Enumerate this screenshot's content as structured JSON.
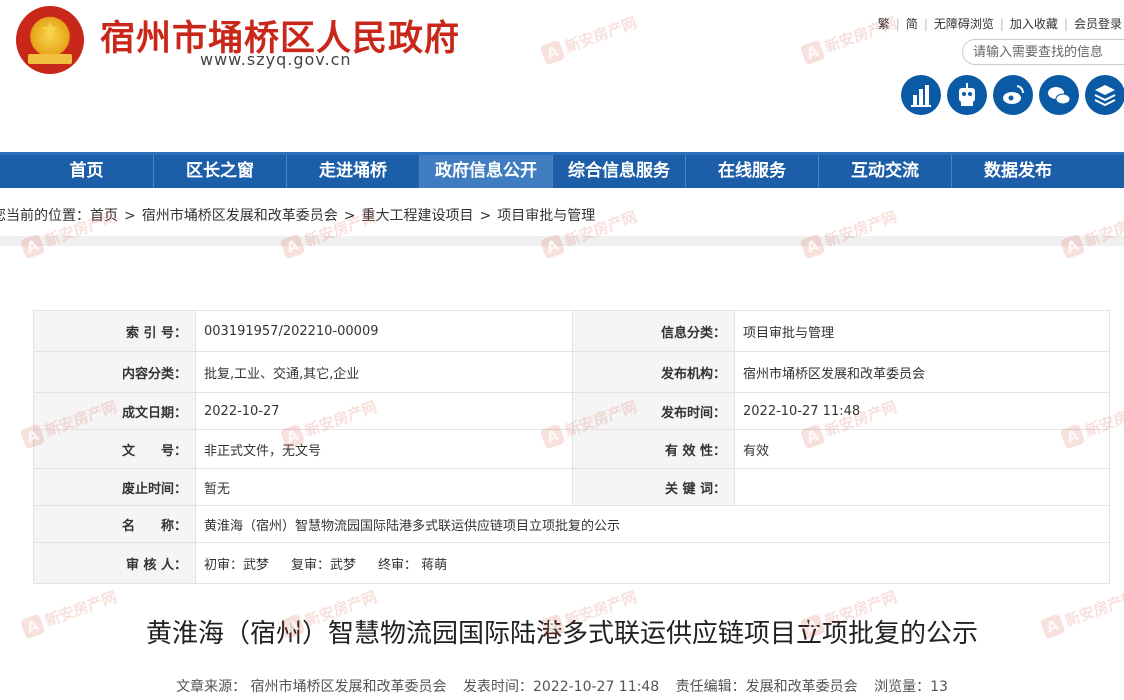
{
  "header": {
    "title": "宿州市埇桥区人民政府",
    "url": "www.szyq.gov.cn",
    "top_links": [
      "繁",
      "简",
      "无障碍浏览",
      "加入收藏",
      "会员登录"
    ],
    "search_placeholder": "请输入需要查找的信息",
    "social_icons": [
      "chart-icon",
      "robot-icon",
      "weibo-icon",
      "wechat-icon",
      "layers-icon"
    ]
  },
  "nav": {
    "items": [
      "首页",
      "区长之窗",
      "走进埇桥",
      "政府信息公开",
      "综合信息服务",
      "在线服务",
      "互动交流",
      "数据发布"
    ],
    "active": "政府信息公开"
  },
  "breadcrumb": {
    "prefix": "您当前的位置：",
    "items": [
      "首页",
      "宿州市埇桥区发展和改革委员会",
      "重大工程建设项目",
      "项目审批与管理"
    ]
  },
  "meta": {
    "index_label": "索 引 号：",
    "index_value": "003191957/202210-00009",
    "info_class_label": "信息分类：",
    "info_class_value": "项目审批与管理",
    "content_class_label": "内容分类：",
    "content_class_value": "批复,工业、交通,其它,企业",
    "publisher_label": "发布机构：",
    "publisher_value": "宿州市埇桥区发展和改革委员会",
    "date_label": "成文日期：",
    "date_value": "2022-10-27",
    "pub_time_label": "发布时间：",
    "pub_time_value": "2022-10-27 11:48",
    "doc_no_label": "文　　号：",
    "doc_no_value": "非正式文件，无文号",
    "validity_label": "有 效 性：",
    "validity_value": "有效",
    "abolish_label": "废止时间：",
    "abolish_value": "暂无",
    "keywords_label": "关 键 词：",
    "keywords_value": "",
    "name_label": "名　　称：",
    "name_value": "黄淮海（宿州）智慧物流园国际陆港多式联运供应链项目立项批复的公示",
    "reviewer_label": "审 核 人：",
    "first_review": "初审：武梦",
    "second_review": "复审：武梦",
    "final_review": "终审： 蒋萌"
  },
  "article": {
    "title": "黄淮海（宿州）智慧物流园国际陆港多式联运供应链项目立项批复的公示",
    "source": "文章来源： 宿州市埇桥区发展和改革委员会",
    "pub_time": "发表时间：2022-10-27 11:48",
    "editor": "责任编辑：发展和改革委员会",
    "views": "浏览量：13"
  },
  "watermark": "新安房产网"
}
